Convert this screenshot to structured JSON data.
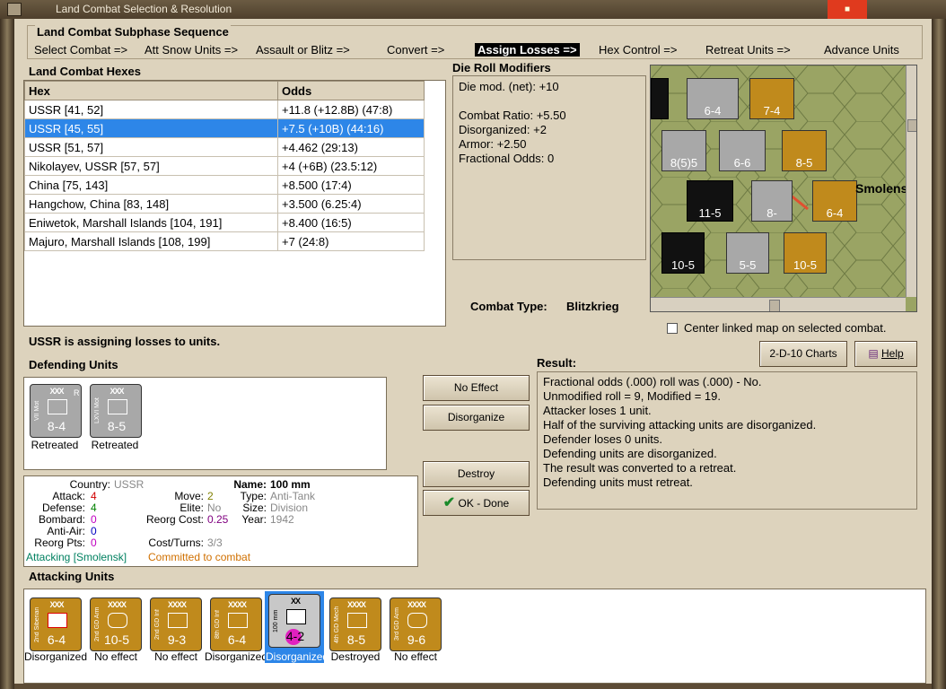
{
  "window": {
    "title": "Land Combat Selection & Resolution"
  },
  "subphase": {
    "header": "Land Combat Subphase Sequence",
    "phases": [
      "Select Combat =>",
      "Att Snow Units =>",
      "Assault or Blitz =>",
      "Convert =>",
      "Assign Losses =>",
      "Hex Control =>",
      "Retreat Units =>",
      "Advance Units"
    ],
    "active_index": 4
  },
  "hexes": {
    "header": "Land Combat Hexes",
    "columns": [
      "Hex",
      "Odds"
    ],
    "rows": [
      [
        "USSR [41, 52]",
        "+11.8 (+12.8B) (47:8)"
      ],
      [
        "USSR [45, 55]",
        "+7.5 (+10B) (44:16)"
      ],
      [
        "USSR [51, 57]",
        "+4.462 (29:13)"
      ],
      [
        "Nikolayev, USSR [57, 57]",
        "+4 (+6B) (23.5:12)"
      ],
      [
        "China [75, 143]",
        "+8.500 (17:4)"
      ],
      [
        "Hangchow, China [83, 148]",
        "+3.500 (6.25:4)"
      ],
      [
        "Eniwetok, Marshall Islands [104, 191]",
        "+8.400 (16:5)"
      ],
      [
        "Majuro, Marshall Islands [108, 199]",
        "+7 (24:8)"
      ]
    ],
    "selected_index": 1
  },
  "die_mods": {
    "header": "Die Roll Modifiers",
    "lines": [
      "Die mod. (net): +10",
      "",
      "Combat Ratio: +5.50",
      "Disorganized: +2",
      "Armor: +2.50",
      "Fractional Odds: 0"
    ]
  },
  "combat_type": {
    "label": "Combat Type:",
    "value": "Blitzkrieg"
  },
  "center_map": {
    "label": "Center linked map on selected combat.",
    "checked": false
  },
  "status": "USSR is assigning losses to units.",
  "buttons": {
    "charts": "2-D-10 Charts",
    "help": "Help",
    "no_effect": "No Effect",
    "disorganize": "Disorganize",
    "destroy": "Destroy",
    "ok_done": "OK - Done"
  },
  "defending": {
    "header": "Defending Units",
    "units": [
      {
        "side": "VII Mot",
        "size": "XXX",
        "extra": "R",
        "value": "8-4",
        "caption": "Retreated"
      },
      {
        "side": "LXVI Mot",
        "size": "XXX",
        "extra": "",
        "value": "8-5",
        "caption": "Retreated"
      }
    ]
  },
  "result": {
    "header": "Result:",
    "lines": [
      "Fractional odds (.000) roll was (.000)  - No.",
      "Unmodified roll = 9, Modified = 19.",
      "Attacker loses 1 unit.",
      "Half of the surviving attacking units are disorganized.",
      "Defender loses 0 units.",
      "Defending units are disorganized.",
      "The result was converted to a retreat.",
      "Defending units must retreat."
    ]
  },
  "info": {
    "country_label": "Country:",
    "country": "USSR",
    "attack_label": "Attack:",
    "attack": "4",
    "defense_label": "Defense:",
    "defense": "4",
    "bombard_label": "Bombard:",
    "bombard": "0",
    "antiair_label": "Anti-Air:",
    "antiair": "0",
    "reorg_label": "Reorg Pts:",
    "reorg": "0",
    "move_label": "Move:",
    "move": "2",
    "elite_label": "Elite:",
    "elite": "No",
    "reorgcost_label": "Reorg Cost:",
    "reorgcost": "0.25",
    "costturns_label": "Cost/Turns:",
    "costturns": "3/3",
    "name_label": "Name:",
    "name": "100 mm",
    "type_label": "Type:",
    "type": "Anti-Tank",
    "size_label": "Size:",
    "size": "Division",
    "year_label": "Year:",
    "year": "1942",
    "attacking": "Attacking [Smolensk]",
    "committed": "Committed to combat"
  },
  "attacking": {
    "header": "Attacking Units",
    "units": [
      {
        "side": "2nd Siberian",
        "size": "XXX",
        "value": "6-4",
        "caption": "Disorganized",
        "symbol": "inf-red"
      },
      {
        "side": "2nd GD Arm",
        "size": "XXXX",
        "value": "10-5",
        "caption": "No effect",
        "symbol": "arm"
      },
      {
        "side": "2nd GD Inf",
        "size": "XXXX",
        "value": "9-3",
        "caption": "No effect",
        "symbol": "inf"
      },
      {
        "side": "8th GD Inf",
        "size": "XXXX",
        "value": "6-4",
        "caption": "Disorganized",
        "symbol": "inf"
      },
      {
        "side": "100 mm",
        "size": "XX",
        "value": "4-2",
        "caption": "Disorganized",
        "symbol": "at"
      },
      {
        "side": "4th GD Mech",
        "size": "XXXX",
        "value": "8-5",
        "caption": "Destroyed",
        "symbol": "mech"
      },
      {
        "side": "3rd GD Arm",
        "size": "XXXX",
        "value": "9-6",
        "caption": "No effect",
        "symbol": "arm"
      }
    ],
    "selected_index": 4
  },
  "map_labels": {
    "city": "Smolensk"
  },
  "colors": {
    "soviet_gold": "#c08a1c",
    "german_gray": "#a8a8a8",
    "selection_blue": "#2d86e8",
    "panel_bg": "#ddd3bd"
  }
}
